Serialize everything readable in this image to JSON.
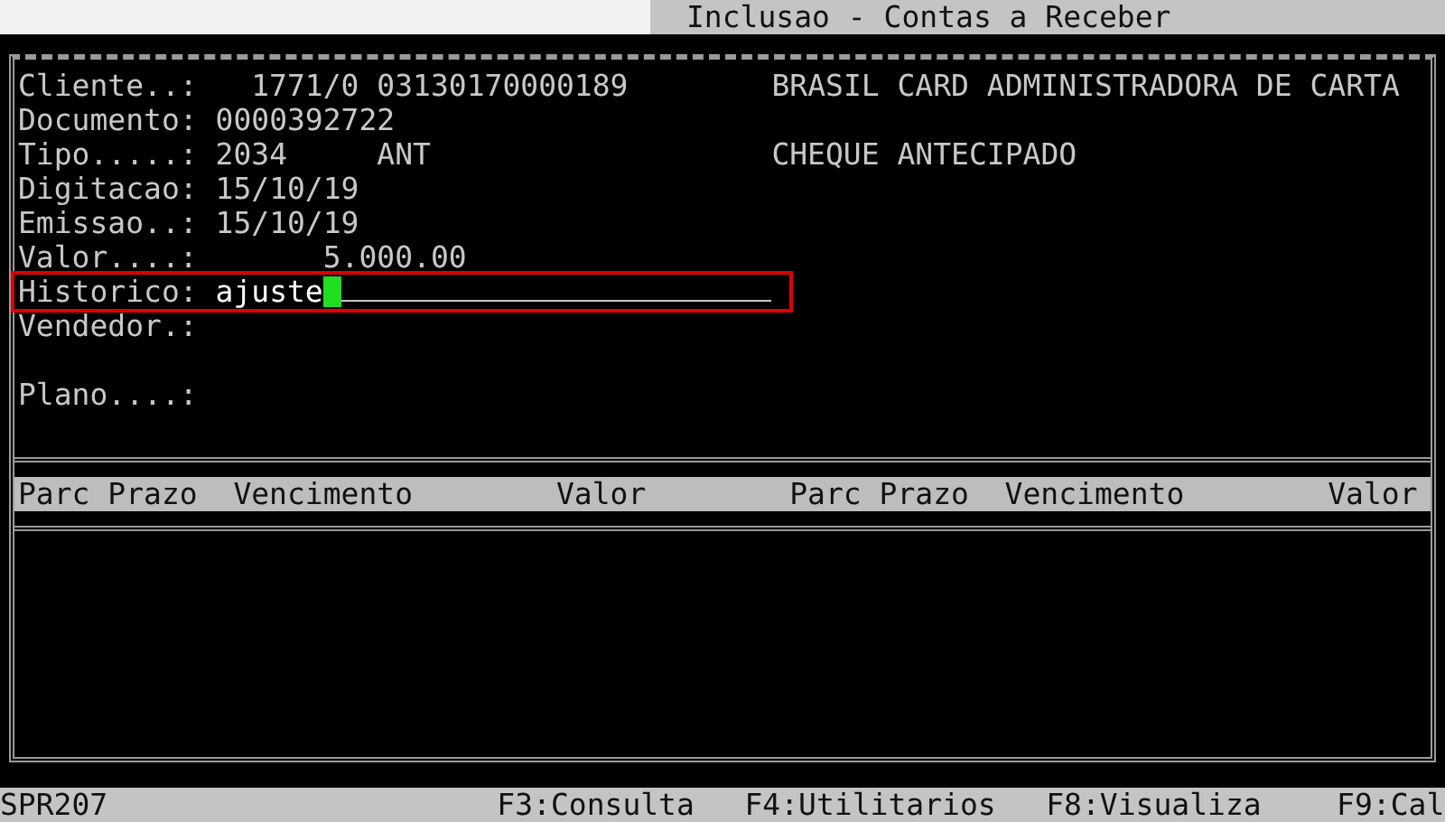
{
  "window": {
    "title": "Inclusao - Contas a Receber"
  },
  "fields": [
    {
      "kind": "code",
      "label": "Cliente..:",
      "value": "1771/0 03130170000189",
      "description": "BRASIL CARD ADMINISTRADORA DE CARTA"
    },
    {
      "kind": "text",
      "label": "Documento:",
      "value": "0000392722"
    },
    {
      "kind": "text",
      "label": "Tipo.....:",
      "value": "2034",
      "extra": "ANT",
      "description": "CHEQUE ANTECIPADO"
    },
    {
      "kind": "text",
      "label": "Digitacao:",
      "value": "15/10/19"
    },
    {
      "kind": "text",
      "label": "Emissao..:",
      "value": "15/10/19"
    },
    {
      "kind": "amount",
      "label": "Valor....:",
      "value": "5.000.00"
    },
    {
      "kind": "input",
      "label": "Historico:",
      "value": "ajuste",
      "focused": true,
      "highlighted": true
    },
    {
      "kind": "text",
      "label": "Vendedor.:"
    },
    {
      "kind": "text",
      "label": "Plano....:"
    }
  ],
  "table": {
    "columns": [
      "Parc",
      "Prazo",
      "Vencimento",
      "Valor",
      "Parc",
      "Prazo",
      "Vencimento",
      "Valor"
    ]
  },
  "status_bar": {
    "program": "SPR207",
    "keys": [
      "F3:Consulta",
      "F4:Utilitarios",
      "F8:Visualiza",
      "F9:Cal"
    ]
  }
}
